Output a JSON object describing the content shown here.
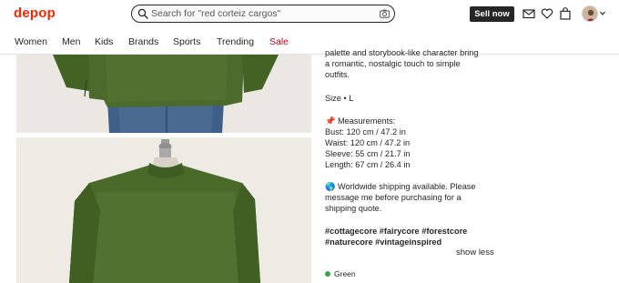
{
  "header": {
    "logo": "depop",
    "search_placeholder": "Search for \"red corteiz cargos\"",
    "sell_label": "Sell now"
  },
  "nav": {
    "items": [
      "Women",
      "Men",
      "Kids",
      "Brands",
      "Sports",
      "Trending",
      "Sale"
    ]
  },
  "description": {
    "intro_line1": "palette and storybook-like character bring",
    "intro_line2": "a romantic, nostalgic touch to simple",
    "intro_line3": "outfits.",
    "size": "Size • L",
    "measurements_title": "📌 Measurements:",
    "bust": "Bust: 120 cm / 47.2 in",
    "waist": "Waist: 120 cm / 47.2 in",
    "sleeve": "Sleeve: 55 cm / 21.7 in",
    "length": "Length: 67 cm / 26.4 in",
    "shipping_line1": "🌎 Worldwide shipping available. Please",
    "shipping_line2": "message me before purchasing for a",
    "shipping_line3": "shipping quote.",
    "tags_line1": "#cottagecore #fairycore #forestcore",
    "tags_line2": "#naturecore #vintageinspired",
    "show_less": "show less"
  },
  "attributes": {
    "color": "Green",
    "color_hex": "#3aa54a"
  },
  "colors": {
    "brand": "#ff2300",
    "sale": "#c4001a"
  }
}
